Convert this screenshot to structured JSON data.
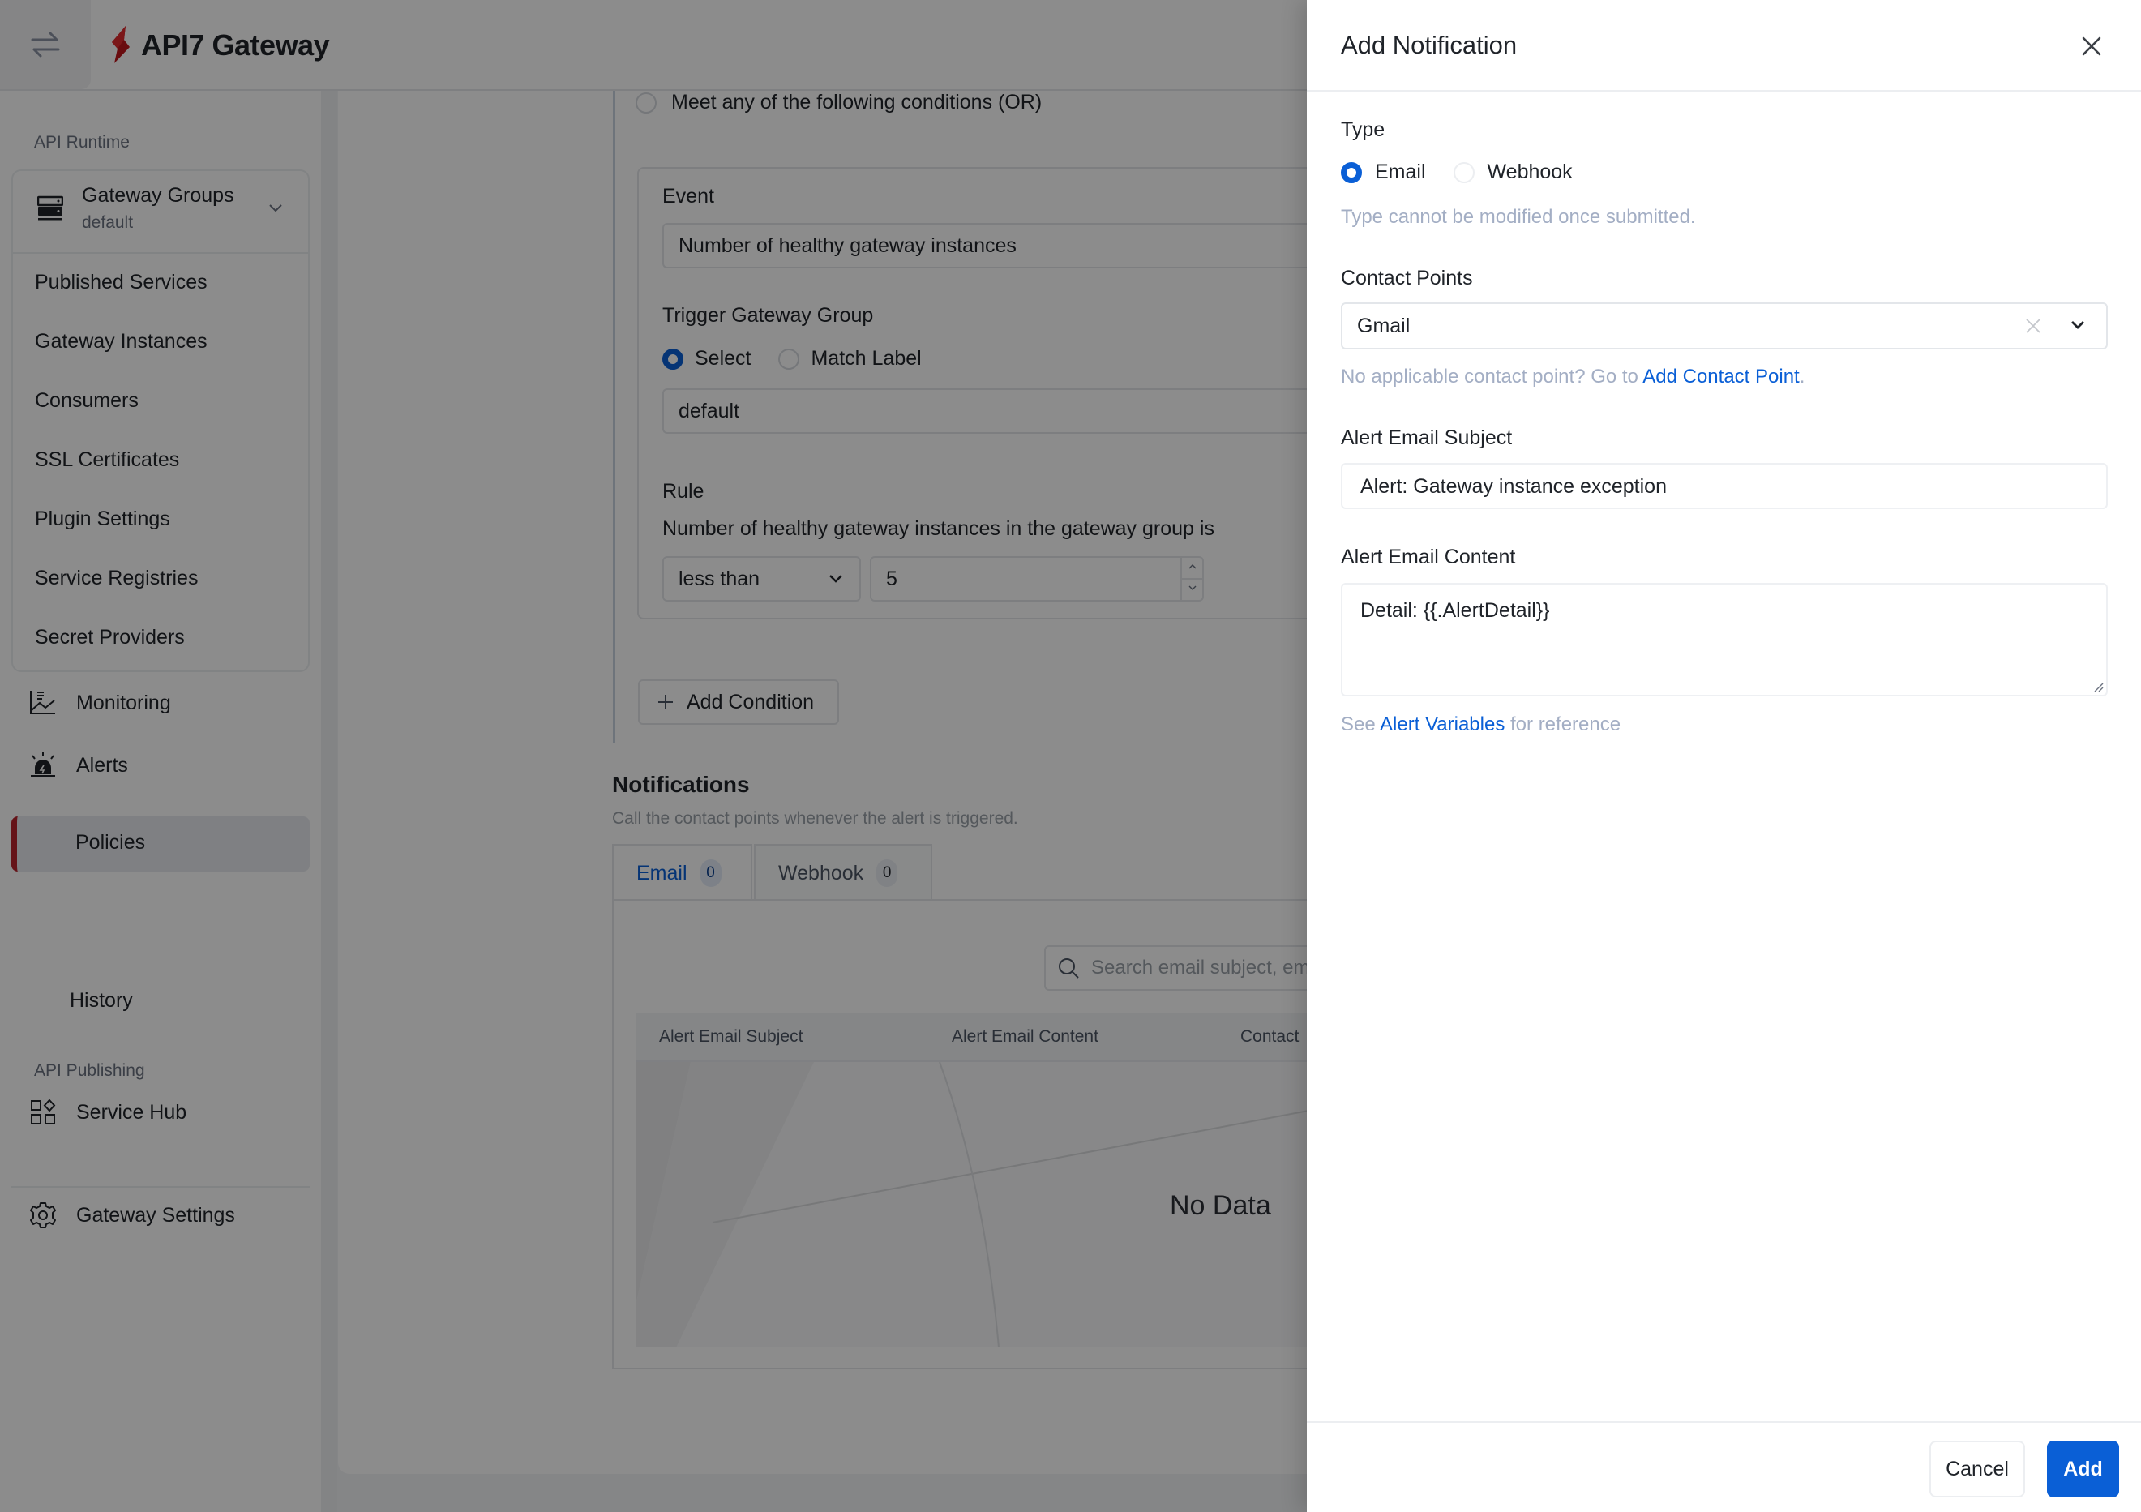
{
  "app": {
    "brand_name": "API7 Gateway",
    "accent_color": "#0a5fd6",
    "brand_color": "#b8232c"
  },
  "sidebar": {
    "section_runtime": "API Runtime",
    "gateway_groups": {
      "title": "Gateway Groups",
      "selected": "default",
      "items": [
        "Published Services",
        "Gateway Instances",
        "Consumers",
        "SSL Certificates",
        "Plugin Settings",
        "Service Registries",
        "Secret Providers"
      ]
    },
    "monitoring": "Monitoring",
    "alerts": {
      "label": "Alerts",
      "expanded": true,
      "items": [
        "Policies",
        "History"
      ],
      "active": "Policies"
    },
    "section_publishing": "API Publishing",
    "service_hub": "Service Hub",
    "gateway_settings": "Gateway Settings"
  },
  "main": {
    "or_option": "Meet any of the following conditions (OR)",
    "condition": {
      "event_label": "Event",
      "event_value": "Number of healthy gateway instances",
      "trigger_label": "Trigger Gateway Group",
      "trigger_options": [
        "Select",
        "Match Label"
      ],
      "trigger_selected": "Select",
      "trigger_value": "default",
      "rule_label": "Rule",
      "rule_text": "Number of healthy gateway instances in the gateway group is",
      "operator": "less than",
      "threshold": "5"
    },
    "add_condition": "Add Condition",
    "notifications": {
      "title": "Notifications",
      "description": "Call the contact points whenever the alert is triggered.",
      "tabs": [
        {
          "label": "Email",
          "count": "0",
          "active": true
        },
        {
          "label": "Webhook",
          "count": "0",
          "active": false
        }
      ],
      "search_placeholder": "Search email subject, em",
      "columns": [
        "Alert Email Subject",
        "Alert Email Content",
        "Contact"
      ],
      "empty_text": "No Data"
    }
  },
  "drawer": {
    "title": "Add Notification",
    "type_label": "Type",
    "type_options": [
      "Email",
      "Webhook"
    ],
    "type_selected": "Email",
    "type_hint": "Type cannot be modified once submitted.",
    "contact_label": "Contact Points",
    "contact_value": "Gmail",
    "contact_hint_prefix": "No applicable contact point? Go to ",
    "contact_hint_link": "Add Contact Point",
    "contact_hint_suffix": ".",
    "subject_label": "Alert Email Subject",
    "subject_value": "Alert: Gateway instance exception",
    "content_label": "Alert Email Content",
    "content_value": "Detail: {{.AlertDetail}}",
    "vars_hint_prefix": "See ",
    "vars_hint_link": "Alert Variables",
    "vars_hint_suffix": " for reference",
    "cancel_label": "Cancel",
    "add_label": "Add"
  }
}
